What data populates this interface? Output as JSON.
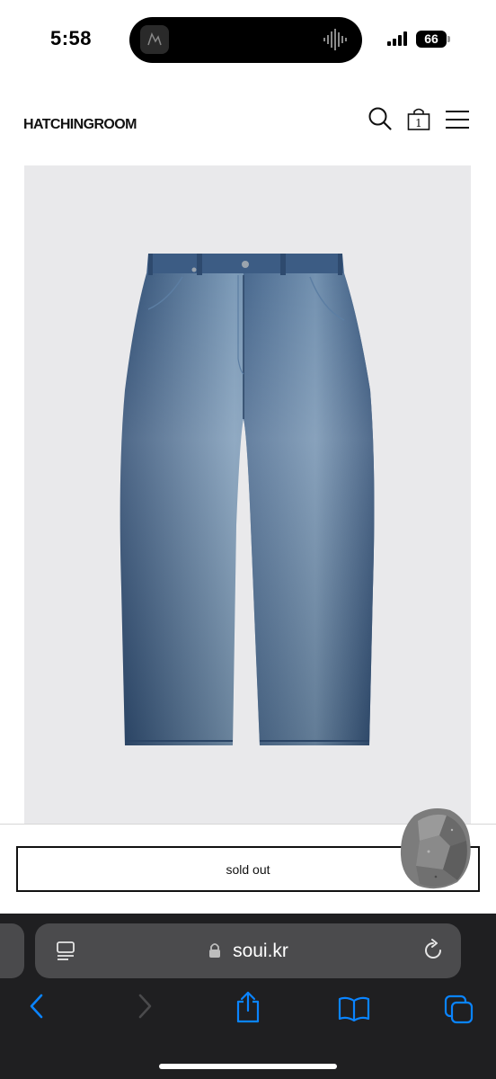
{
  "status_bar": {
    "time": "5:58",
    "battery": "66"
  },
  "site": {
    "logo": "HATCHINGROOM",
    "cart_count": "1"
  },
  "product": {
    "button_label": "sold out"
  },
  "browser": {
    "url": "soui.kr"
  },
  "icons": {
    "search": "search-icon",
    "cart": "cart-icon",
    "menu": "menu-icon",
    "back": "chevron-left-icon",
    "forward": "chevron-right-icon",
    "share": "share-icon",
    "bookmarks": "book-icon",
    "tabs": "tabs-icon",
    "reload": "reload-icon",
    "lock": "lock-icon"
  },
  "colors": {
    "accent": "#0a84ff",
    "toolbar_bg": "#1f1f21",
    "address_bg": "#4b4b4d",
    "image_bg": "#e9e9eb",
    "denim": "#3f5f86"
  }
}
